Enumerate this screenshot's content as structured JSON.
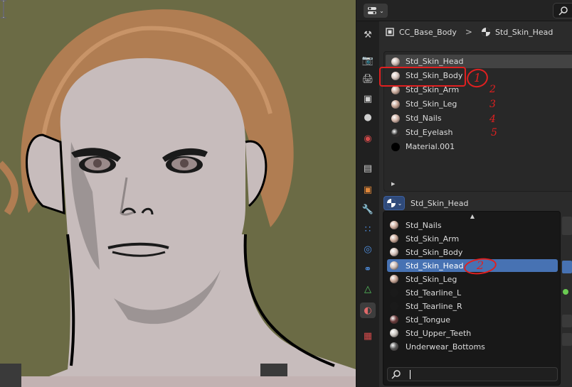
{
  "viewport": {
    "background": "#6b6b45",
    "cursor_icon": "text-cursor-icon"
  },
  "topbar": {
    "editor_type_icon": "properties-editor-icon",
    "search_icon": "search-icon"
  },
  "tabs": [
    {
      "name": "tool",
      "icon": "tool-icon"
    },
    {
      "name": "render",
      "icon": "render-icon"
    },
    {
      "name": "output",
      "icon": "output-icon"
    },
    {
      "name": "view-layer",
      "icon": "view-layer-icon"
    },
    {
      "name": "scene",
      "icon": "scene-icon"
    },
    {
      "name": "world",
      "icon": "world-icon"
    },
    {
      "name": "collection",
      "icon": "collection-icon"
    },
    {
      "name": "object",
      "icon": "object-icon"
    },
    {
      "name": "modifiers",
      "icon": "wrench-icon"
    },
    {
      "name": "particles",
      "icon": "particles-icon"
    },
    {
      "name": "physics",
      "icon": "physics-icon"
    },
    {
      "name": "constraints",
      "icon": "constraints-icon"
    },
    {
      "name": "data",
      "icon": "mesh-data-icon"
    },
    {
      "name": "material",
      "icon": "material-icon"
    },
    {
      "name": "texture",
      "icon": "texture-icon"
    }
  ],
  "breadcrumb": {
    "object": "CC_Base_Body",
    "separator": ">",
    "material": "Std_Skin_Head"
  },
  "slots": [
    {
      "name": "Std_Skin_Head",
      "color": "#cdbcb5",
      "selected": true
    },
    {
      "name": "Std_Skin_Body",
      "color": "#d9c8c1",
      "selected": false
    },
    {
      "name": "Std_Skin_Arm",
      "color": "#c8a99a",
      "selected": false
    },
    {
      "name": "Std_Skin_Leg",
      "color": "#c6a494",
      "selected": false
    },
    {
      "name": "Std_Nails",
      "color": "#d1b3a6",
      "selected": false
    },
    {
      "name": "Std_Eyelash",
      "color": "#2a2a2a",
      "selected": false
    },
    {
      "name": "Material.001",
      "color": "#000000",
      "selected": false
    }
  ],
  "material_field": {
    "value": "Std_Skin_Head"
  },
  "dropdown": {
    "items": [
      {
        "name": "Std_Nails",
        "color": "#cfae9f",
        "selected": false
      },
      {
        "name": "Std_Skin_Arm",
        "color": "#c9a898",
        "selected": false
      },
      {
        "name": "Std_Skin_Body",
        "color": "#d6c3bb",
        "selected": false
      },
      {
        "name": "Std_Skin_Head",
        "color": "#cdbcb5",
        "selected": true
      },
      {
        "name": "Std_Skin_Leg",
        "color": "#c7a595",
        "selected": false
      },
      {
        "name": "Std_Tearline_L",
        "color": "#1a1a1a",
        "selected": false
      },
      {
        "name": "Std_Tearline_R",
        "color": "#1a1a1a",
        "selected": false
      },
      {
        "name": "Std_Tongue",
        "color": "#6a3a3a",
        "selected": false
      },
      {
        "name": "Std_Upper_Teeth",
        "color": "#c9c5bf",
        "selected": false
      },
      {
        "name": "Underwear_Bottoms",
        "color": "#5a5a5a",
        "selected": false
      }
    ],
    "search_value": ""
  },
  "annotations": {
    "n1": "1",
    "n2": "2",
    "n3": "3",
    "n4": "4",
    "n5": "5",
    "circle2": "2"
  }
}
